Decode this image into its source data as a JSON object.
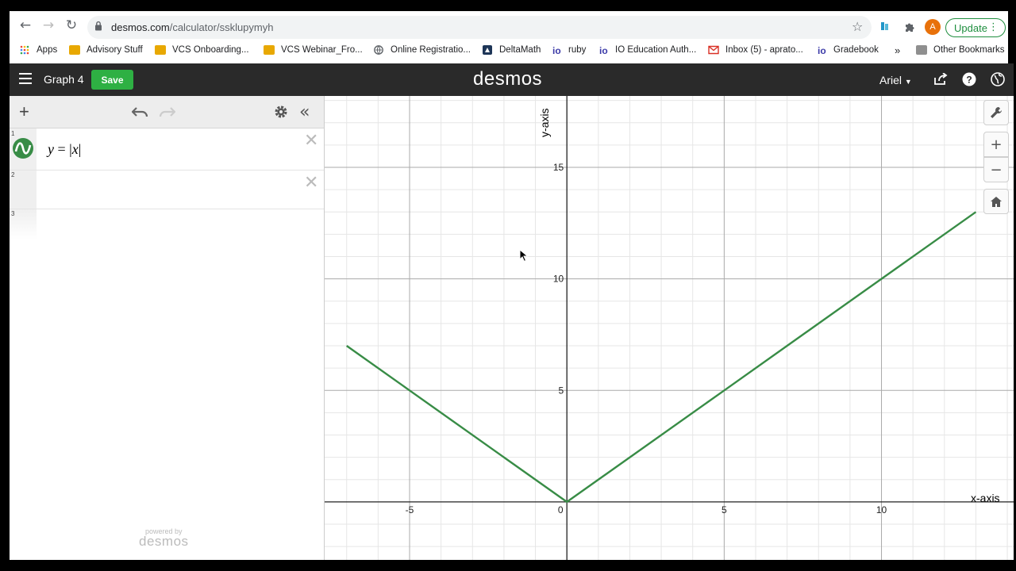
{
  "browser": {
    "url_host": "desmos.com",
    "url_path": "/calculator/ssklupymyh",
    "avatar_letter": "A",
    "update_label": "Update",
    "bookmarks": [
      {
        "label": "Apps",
        "icon": "apps-grid-icon"
      },
      {
        "label": "Advisory Stuff",
        "icon": "folder-icon"
      },
      {
        "label": "VCS Onboarding...",
        "icon": "folder-icon"
      },
      {
        "label": "VCS Webinar_Fro...",
        "icon": "folder-icon"
      },
      {
        "label": "Online Registratio...",
        "icon": "globe-icon"
      },
      {
        "label": "DeltaMath",
        "icon": "deltamath-icon"
      },
      {
        "label": "ruby",
        "icon": "io-icon"
      },
      {
        "label": "IO Education Auth...",
        "icon": "io-icon"
      },
      {
        "label": "Inbox (5) - aprato...",
        "icon": "gmail-icon"
      },
      {
        "label": "Gradebook",
        "icon": "io-icon"
      }
    ],
    "more_bookmarks": "»",
    "other_bookmarks": "Other Bookmarks"
  },
  "header": {
    "graph_title": "Graph 4",
    "save_label": "Save",
    "logo": "desmos",
    "user_name": "Ariel"
  },
  "expressions": [
    {
      "num": "1",
      "latex_y": "y",
      "eq": " = ",
      "abs_open": "|",
      "x": "x",
      "abs_close": "|",
      "color": "#388c46"
    },
    {
      "num": "2"
    },
    {
      "num": "3"
    }
  ],
  "powered": {
    "line1": "powered by",
    "line2": "desmos"
  },
  "chart_data": {
    "type": "line",
    "series": [
      {
        "expression": "y = |x|",
        "color": "#388c46",
        "x": [
          -7,
          -5,
          0,
          5,
          10,
          13
        ],
        "y": [
          7,
          5,
          0,
          5,
          10,
          13
        ]
      }
    ],
    "xlim": [
      -7.7,
      14.2
    ],
    "ylim": [
      -2.6,
      18.2
    ],
    "xlabel": "x-axis",
    "ylabel": "y-axis",
    "x_ticks": [
      "-5",
      "0",
      "5",
      "10"
    ],
    "y_ticks": [
      "5",
      "10",
      "15"
    ],
    "grid": true
  }
}
